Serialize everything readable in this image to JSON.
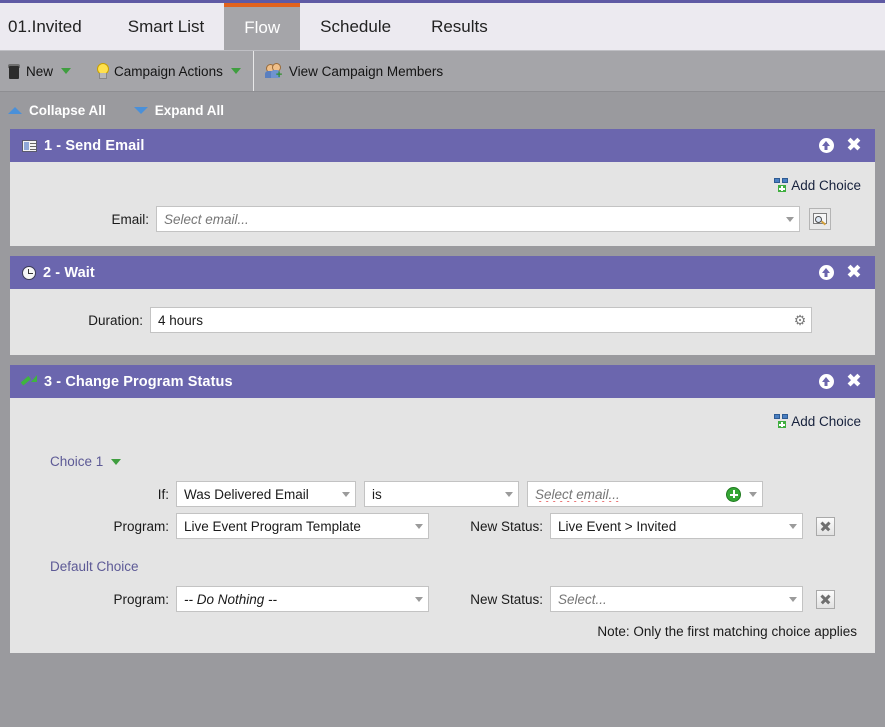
{
  "tabs": [
    {
      "label": "01.Invited",
      "active": false
    },
    {
      "label": "Smart List",
      "active": false
    },
    {
      "label": "Flow",
      "active": true
    },
    {
      "label": "Schedule",
      "active": false
    },
    {
      "label": "Results",
      "active": false
    }
  ],
  "toolbar": {
    "new_label": "New",
    "campaign_actions_label": "Campaign Actions",
    "view_members_label": "View Campaign Members"
  },
  "tree_controls": {
    "collapse_all": "Collapse All",
    "expand_all": "Expand All"
  },
  "steps": [
    {
      "title": "1 - Send Email",
      "icon": "email-icon",
      "add_choice_label": "Add Choice",
      "email_label": "Email:",
      "email_placeholder": "Select email..."
    },
    {
      "title": "2 - Wait",
      "icon": "clock-icon",
      "duration_label": "Duration:",
      "duration_value": "4 hours"
    },
    {
      "title": "3 - Change Program Status",
      "icon": "green-arrow-icon",
      "add_choice_label": "Add Choice",
      "choice1_label": "Choice 1",
      "if_label": "If:",
      "if_trigger": "Was Delivered Email",
      "if_operator": "is",
      "if_value_placeholder": "Select email...",
      "program_label": "Program:",
      "program_value": "Live Event Program Template",
      "new_status_label": "New Status:",
      "new_status_value": "Live Event > Invited",
      "default_choice_label": "Default Choice",
      "default_program_label": "Program:",
      "default_program_value": "-- Do Nothing --",
      "default_status_label": "New Status:",
      "default_status_placeholder": "Select...",
      "note": "Note: Only the first matching choice applies"
    }
  ],
  "colors": {
    "accent_purple": "#6b66ae",
    "tab_active_orange": "#e2631e",
    "link_purple": "#5d5a96",
    "page_gray": "#9a9a9e",
    "panel_gray": "#e4e4e4"
  }
}
